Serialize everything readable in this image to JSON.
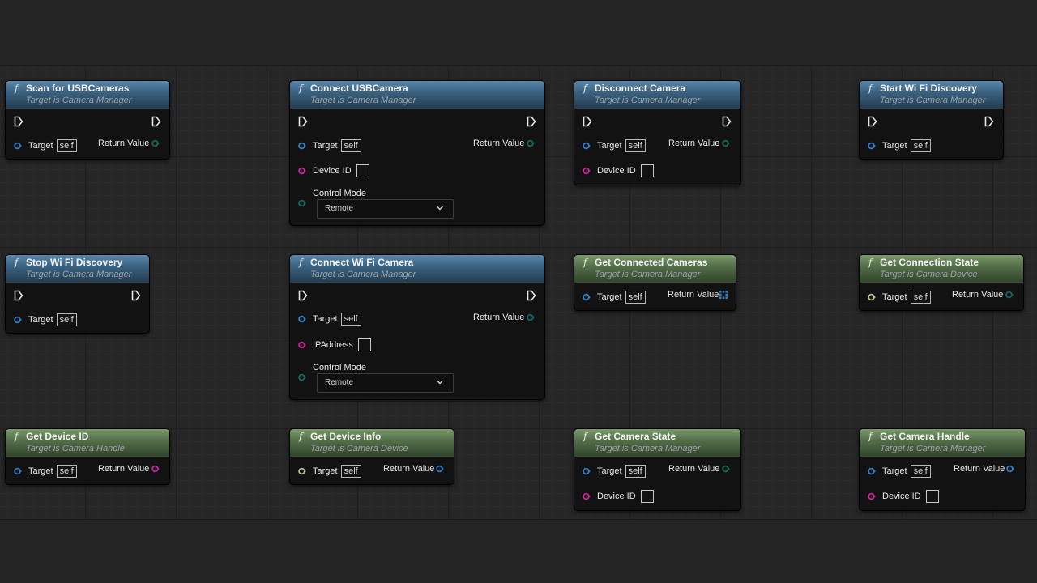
{
  "colors": {
    "canvas": "#262626",
    "header_blue": "#3b6382",
    "header_green": "#55704a",
    "pin_object": "#2d82c7",
    "pin_string": "#d01fa3",
    "pin_enum": "#0e6b60",
    "pin_struct": "#bcc48e"
  },
  "labels": {
    "target": "Target",
    "self": "self",
    "return_value": "Return Value",
    "device_id": "Device ID",
    "ip_address": "IPAddress",
    "control_mode": "Control Mode"
  },
  "nodes": {
    "scan_usb": {
      "title": "Scan for USBCameras",
      "subtitle": "Target is Camera Manager"
    },
    "connect_usb": {
      "title": "Connect USBCamera",
      "subtitle": "Target is Camera Manager",
      "control_mode_value": "Remote"
    },
    "disconnect": {
      "title": "Disconnect Camera",
      "subtitle": "Target is Camera Manager"
    },
    "start_wifi": {
      "title": "Start Wi Fi Discovery",
      "subtitle": "Target is Camera Manager"
    },
    "stop_wifi": {
      "title": "Stop Wi Fi Discovery",
      "subtitle": "Target is Camera Manager"
    },
    "connect_wifi": {
      "title": "Connect Wi Fi Camera",
      "subtitle": "Target is Camera Manager",
      "control_mode_value": "Remote"
    },
    "get_connected": {
      "title": "Get Connected Cameras",
      "subtitle": "Target is Camera Manager"
    },
    "get_conn_state": {
      "title": "Get Connection State",
      "subtitle": "Target is Camera Device"
    },
    "get_device_id": {
      "title": "Get Device ID",
      "subtitle": "Target is Camera Handle"
    },
    "get_device_info": {
      "title": "Get Device Info",
      "subtitle": "Target is Camera Device"
    },
    "get_camera_state": {
      "title": "Get Camera State",
      "subtitle": "Target is Camera Manager"
    },
    "get_camera_handle": {
      "title": "Get Camera Handle",
      "subtitle": "Target is Camera Manager"
    }
  }
}
